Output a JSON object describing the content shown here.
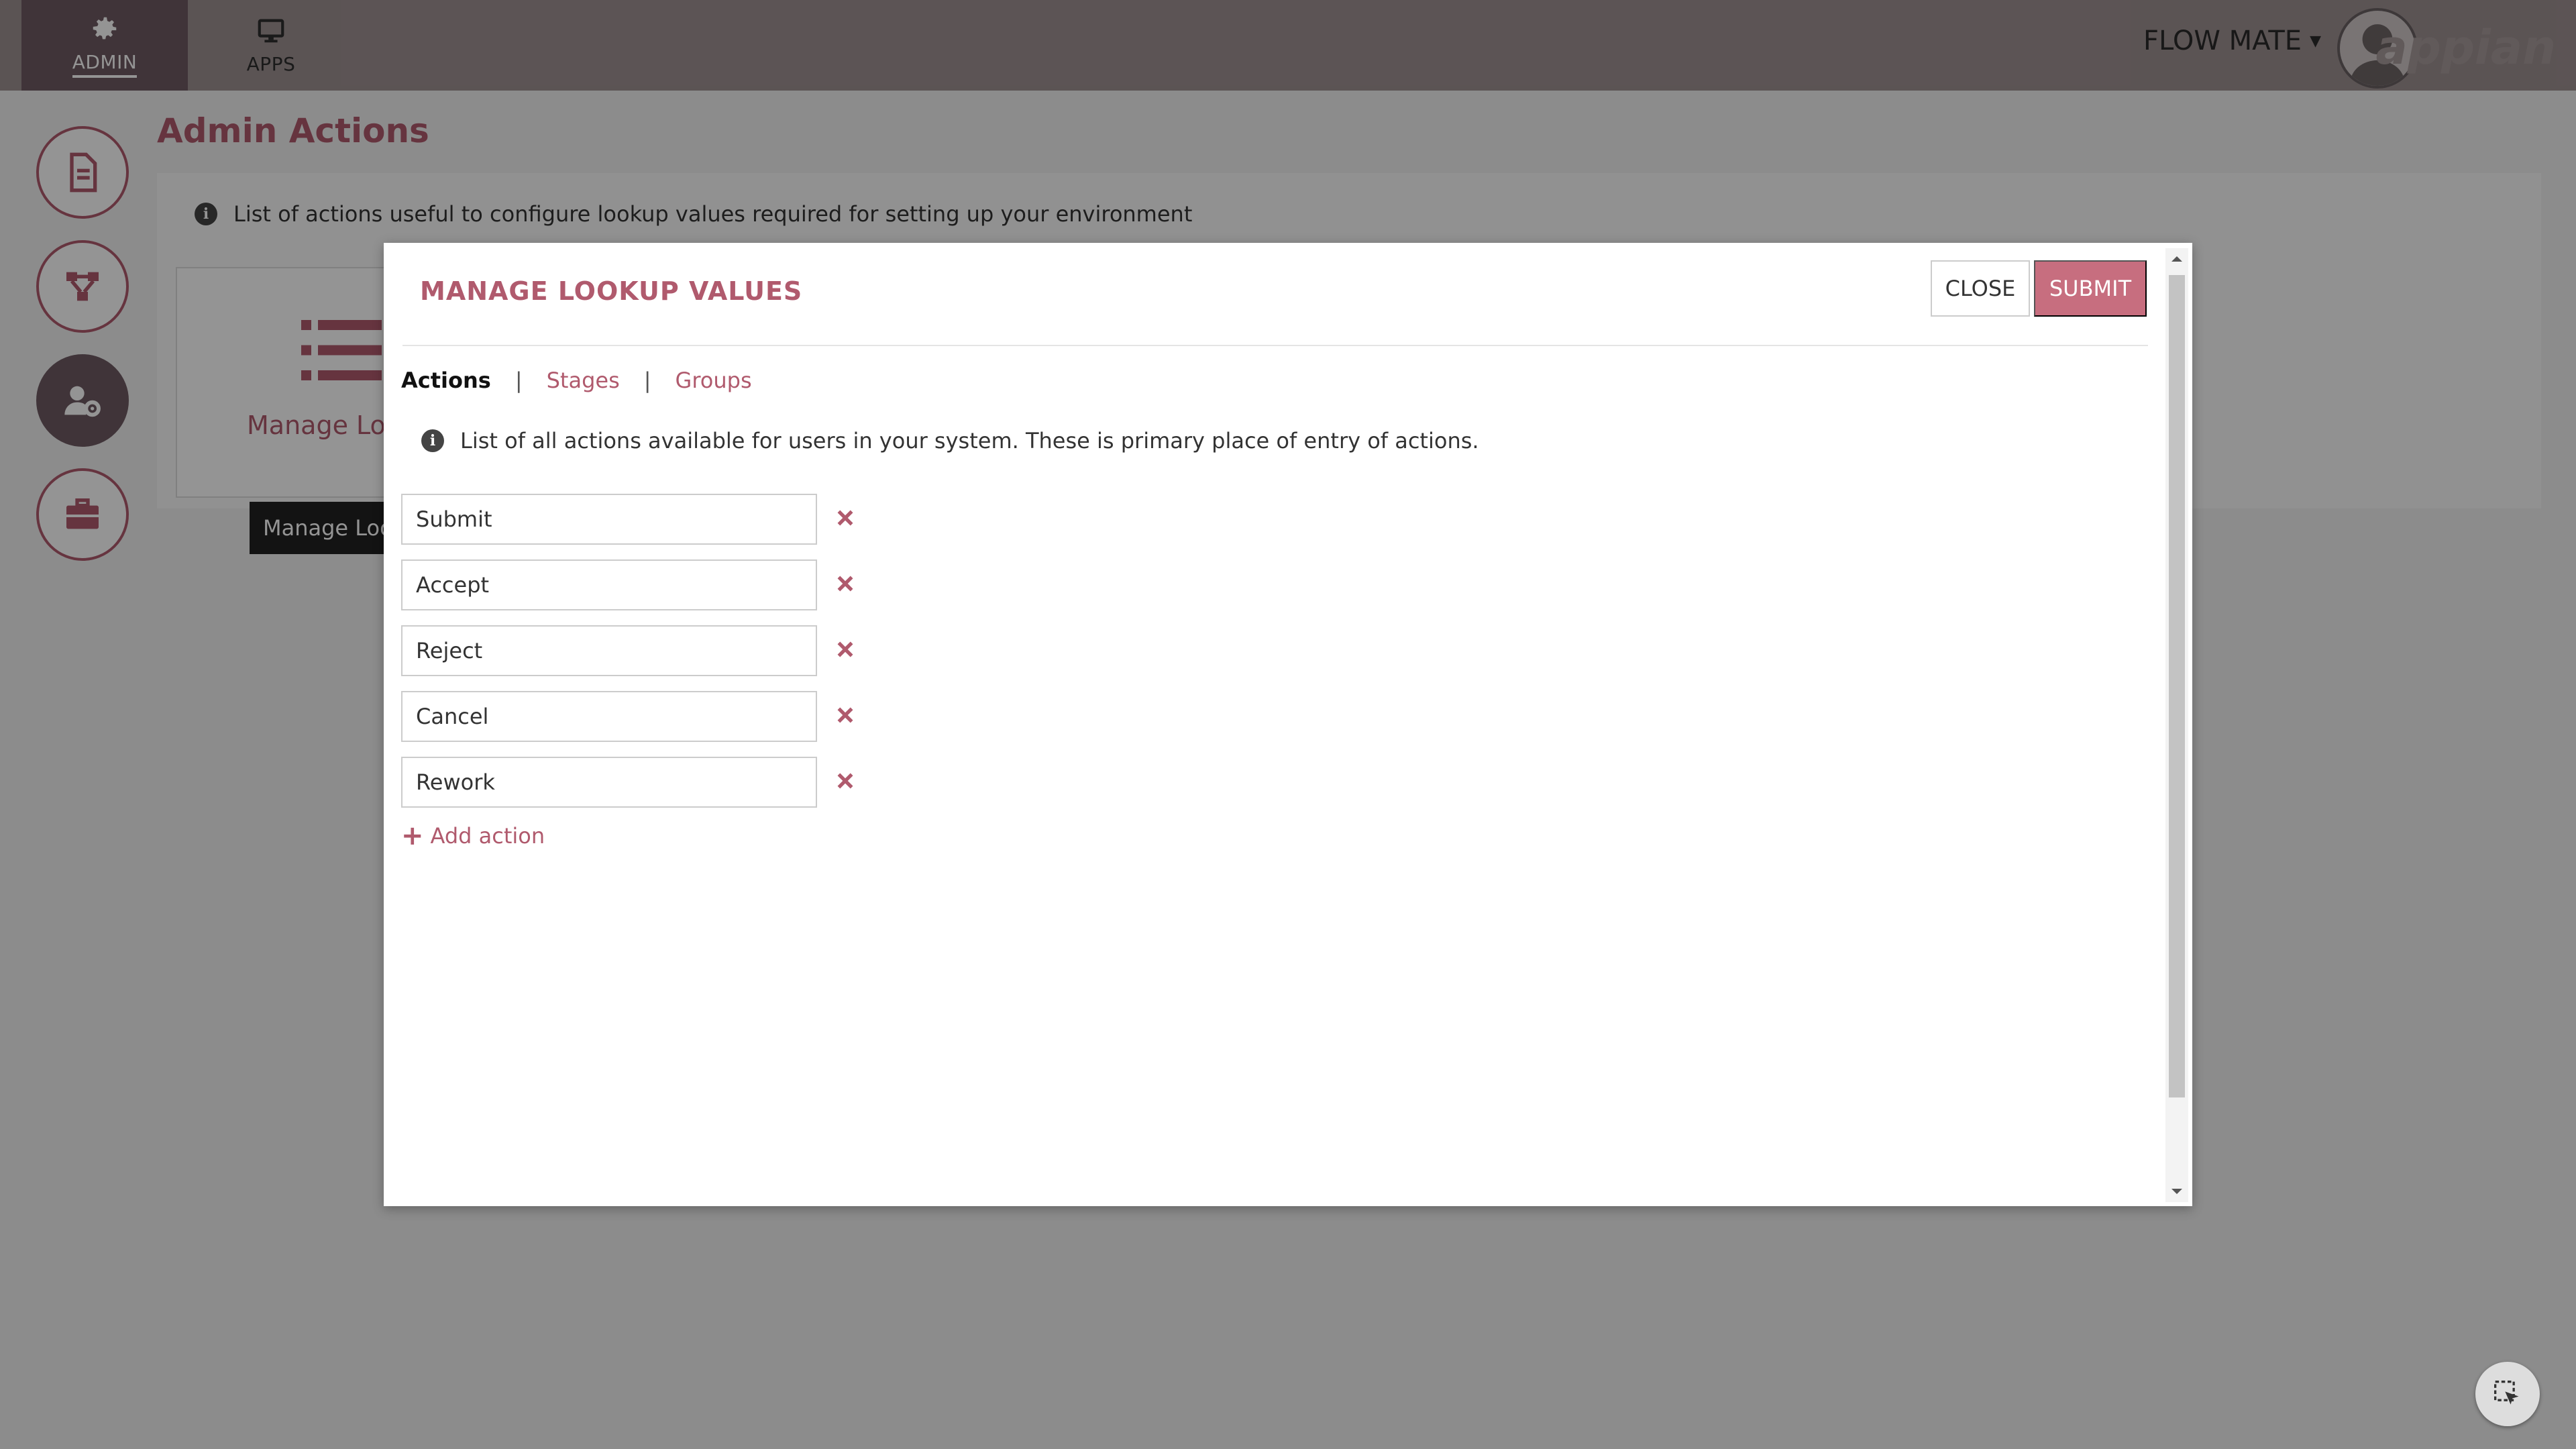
{
  "topbar": {
    "nav": [
      {
        "label": "ADMIN",
        "icon": "gear-icon",
        "active": true
      },
      {
        "label": "APPS",
        "icon": "monitor-icon",
        "active": false
      }
    ],
    "user_name": "FLOW MATE",
    "brand": "appian"
  },
  "sidebar": {
    "items": [
      {
        "icon": "document-icon"
      },
      {
        "icon": "process-flow-icon"
      },
      {
        "icon": "user-settings-icon",
        "active": true
      },
      {
        "icon": "briefcase-icon"
      }
    ]
  },
  "main": {
    "title": "Admin Actions",
    "info_text": "List of actions useful to configure lookup values required for setting up your environment",
    "card_label": "Manage Loc",
    "tooltip": "Manage Loo"
  },
  "modal": {
    "title": "MANAGE LOOKUP VALUES",
    "close_label": "CLOSE",
    "submit_label": "SUBMIT",
    "tabs": [
      {
        "label": "Actions",
        "active": true
      },
      {
        "label": "Stages",
        "active": false
      },
      {
        "label": "Groups",
        "active": false
      }
    ],
    "tab_separator": "|",
    "info_text": "List of all actions available for users in your system. These is primary place of entry of actions.",
    "actions": [
      "Submit",
      "Accept",
      "Reject",
      "Cancel",
      "Rework"
    ],
    "add_label": "Add action"
  },
  "colors": {
    "accent": "#b05a6d",
    "submit_button": "#c76e7f",
    "topbar": "#9e9192",
    "active_nav": "#6f5a62"
  }
}
